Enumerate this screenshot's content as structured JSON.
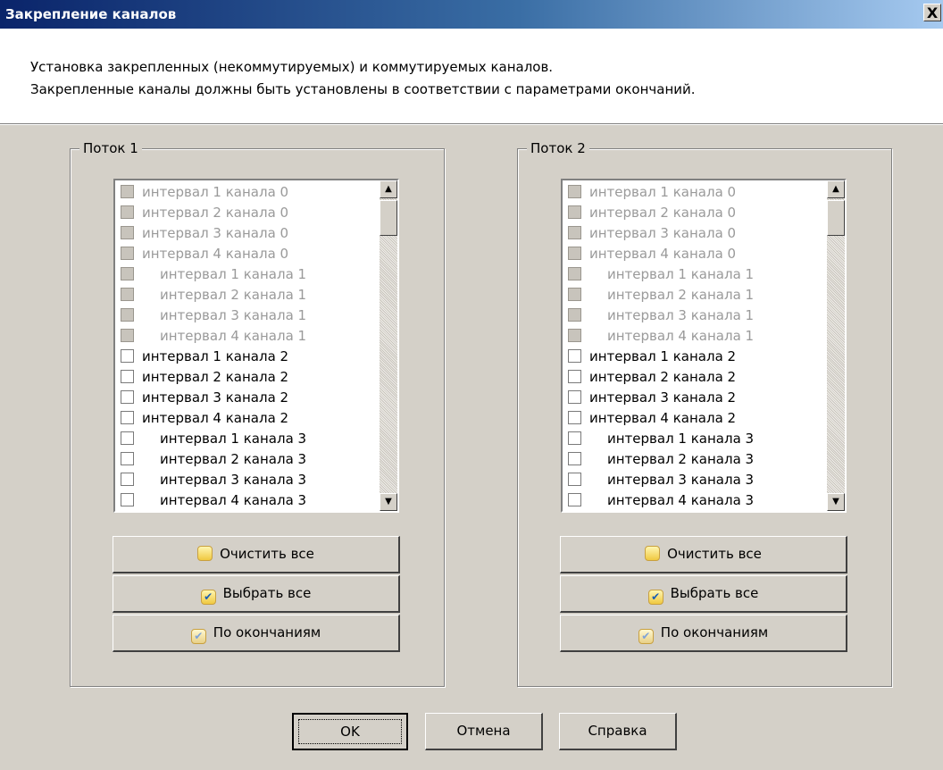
{
  "window": {
    "title": "Закрепление каналов",
    "close_label": "X"
  },
  "header": {
    "line1": "Установка закрепленных (некоммутируемых) и коммутируемых каналов.",
    "line2": "Закрепленные каналы должны быть установлены в соответствии с параметрами окончаний."
  },
  "streams": [
    {
      "title": "Поток 1",
      "items": [
        {
          "label": "интервал 1 канала 0",
          "indent": 0,
          "disabled": true,
          "checked": false
        },
        {
          "label": "интервал 2 канала 0",
          "indent": 0,
          "disabled": true,
          "checked": false
        },
        {
          "label": "интервал 3 канала 0",
          "indent": 0,
          "disabled": true,
          "checked": false
        },
        {
          "label": "интервал 4 канала 0",
          "indent": 0,
          "disabled": true,
          "checked": false
        },
        {
          "label": "интервал 1 канала 1",
          "indent": 1,
          "disabled": true,
          "checked": false
        },
        {
          "label": "интервал 2 канала 1",
          "indent": 1,
          "disabled": true,
          "checked": false
        },
        {
          "label": "интервал 3 канала 1",
          "indent": 1,
          "disabled": true,
          "checked": false
        },
        {
          "label": "интервал 4 канала 1",
          "indent": 1,
          "disabled": true,
          "checked": false
        },
        {
          "label": "интервал 1 канала 2",
          "indent": 0,
          "disabled": false,
          "checked": false
        },
        {
          "label": "интервал 2 канала 2",
          "indent": 0,
          "disabled": false,
          "checked": false
        },
        {
          "label": "интервал 3 канала 2",
          "indent": 0,
          "disabled": false,
          "checked": false
        },
        {
          "label": "интервал 4 канала 2",
          "indent": 0,
          "disabled": false,
          "checked": false
        },
        {
          "label": "интервал 1 канала 3",
          "indent": 1,
          "disabled": false,
          "checked": false
        },
        {
          "label": "интервал 2 канала 3",
          "indent": 1,
          "disabled": false,
          "checked": false
        },
        {
          "label": "интервал 3 канала 3",
          "indent": 1,
          "disabled": false,
          "checked": false
        },
        {
          "label": "интервал 4 канала 3",
          "indent": 1,
          "disabled": false,
          "checked": false
        }
      ],
      "buttons": {
        "clear_all": "Очистить все",
        "select_all": "Выбрать все",
        "by_endpoints": "По окончаниям"
      }
    },
    {
      "title": "Поток 2",
      "items": [
        {
          "label": "интервал 1 канала 0",
          "indent": 0,
          "disabled": true,
          "checked": false
        },
        {
          "label": "интервал 2 канала 0",
          "indent": 0,
          "disabled": true,
          "checked": false
        },
        {
          "label": "интервал 3 канала 0",
          "indent": 0,
          "disabled": true,
          "checked": false
        },
        {
          "label": "интервал 4 канала 0",
          "indent": 0,
          "disabled": true,
          "checked": false
        },
        {
          "label": "интервал 1 канала 1",
          "indent": 1,
          "disabled": true,
          "checked": false
        },
        {
          "label": "интервал 2 канала 1",
          "indent": 1,
          "disabled": true,
          "checked": false
        },
        {
          "label": "интервал 3 канала 1",
          "indent": 1,
          "disabled": true,
          "checked": false
        },
        {
          "label": "интервал 4 канала 1",
          "indent": 1,
          "disabled": true,
          "checked": false
        },
        {
          "label": "интервал 1 канала 2",
          "indent": 0,
          "disabled": false,
          "checked": false
        },
        {
          "label": "интервал 2 канала 2",
          "indent": 0,
          "disabled": false,
          "checked": false
        },
        {
          "label": "интервал 3 канала 2",
          "indent": 0,
          "disabled": false,
          "checked": false
        },
        {
          "label": "интервал 4 канала 2",
          "indent": 0,
          "disabled": false,
          "checked": false
        },
        {
          "label": "интервал 1 канала 3",
          "indent": 1,
          "disabled": false,
          "checked": false
        },
        {
          "label": "интервал 2 канала 3",
          "indent": 1,
          "disabled": false,
          "checked": false
        },
        {
          "label": "интервал 3 канала 3",
          "indent": 1,
          "disabled": false,
          "checked": false
        },
        {
          "label": "интервал 4 канала 3",
          "indent": 1,
          "disabled": false,
          "checked": false
        }
      ],
      "buttons": {
        "clear_all": "Очистить все",
        "select_all": "Выбрать все",
        "by_endpoints": "По окончаниям"
      }
    }
  ],
  "icons": {
    "scroll_up": "scroll-up-arrow-icon",
    "scroll_down": "scroll-down-arrow-icon",
    "clear_all": "empty-checkbox-icon",
    "select_all": "checked-checkbox-icon",
    "by_endpoints": "faded-checked-checkbox-icon"
  },
  "dialog_buttons": {
    "ok": "OK",
    "cancel": "Отмена",
    "help": "Справка"
  }
}
